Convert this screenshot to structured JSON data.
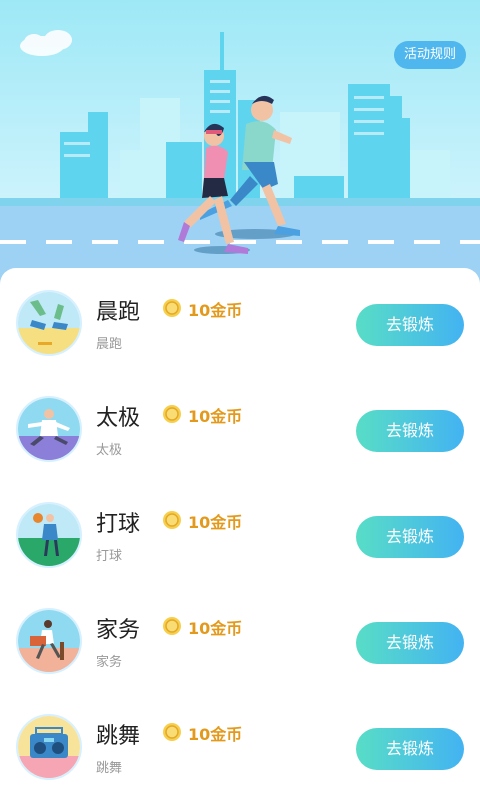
{
  "header": {
    "rules_label": "活动规则"
  },
  "activities": [
    {
      "title": "晨跑",
      "reward": "10金币",
      "subtitle": "晨跑",
      "button": "去锻炼",
      "icon": "running-icon"
    },
    {
      "title": "太极",
      "reward": "10金币",
      "subtitle": "太极",
      "button": "去锻炼",
      "icon": "tai-chi-icon"
    },
    {
      "title": "打球",
      "reward": "10金币",
      "subtitle": "打球",
      "button": "去锻炼",
      "icon": "basketball-icon"
    },
    {
      "title": "家务",
      "reward": "10金币",
      "subtitle": "家务",
      "button": "去锻炼",
      "icon": "housework-icon"
    },
    {
      "title": "跳舞",
      "reward": "10金币",
      "subtitle": "跳舞",
      "button": "去锻炼",
      "icon": "boombox-icon"
    }
  ],
  "colors": {
    "accent": "#43b3f2",
    "reward": "#e39a1c",
    "hero_sky": "#9ee8f6"
  }
}
